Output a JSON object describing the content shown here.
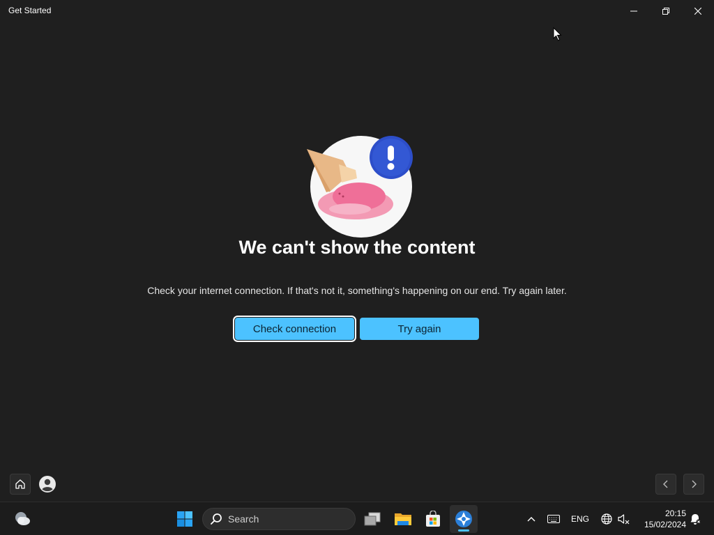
{
  "window": {
    "title": "Get Started",
    "controls": {
      "minimize": "minimize-icon",
      "maximize": "restore-icon",
      "close": "close-icon"
    }
  },
  "error": {
    "illustration": "melted-ice-cream-with-exclamation-badge",
    "heading": "We can't show the content",
    "message": "Check your internet connection. If that's not it, something's happening on our end. Try again later.",
    "check_button": "Check connection",
    "try_button": "Try again"
  },
  "app_nav": {
    "home": "home-icon",
    "profile": "user-icon",
    "back": "chevron-left-icon",
    "forward": "chevron-right-icon"
  },
  "taskbar": {
    "search_label": "Search",
    "apps": [
      "Task View",
      "File Explorer",
      "Microsoft Store",
      "Get Started"
    ],
    "active_app": "Get Started",
    "language": "ENG",
    "time": "20:15",
    "date": "15/02/2024"
  },
  "colors": {
    "background": "#1f1f1f",
    "accent": "#4cc2ff",
    "taskbar": "#1c1c1c"
  }
}
